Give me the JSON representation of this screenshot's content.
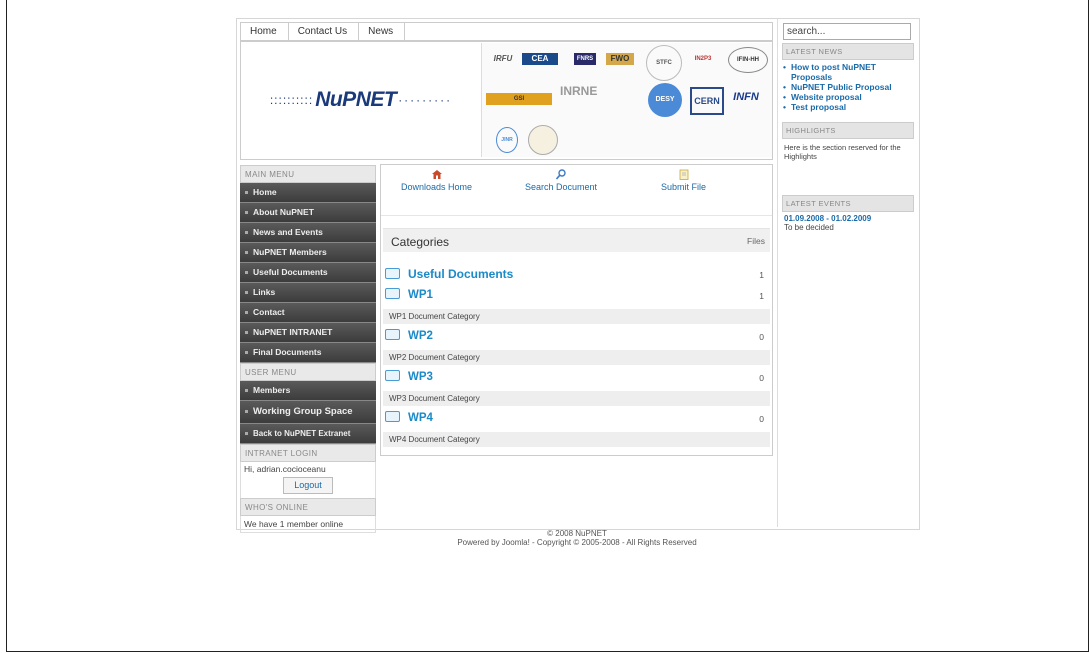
{
  "topnav": {
    "items": [
      "Home",
      "Contact Us",
      "News"
    ]
  },
  "header": {
    "brand": "NuPNET",
    "logos": [
      "IRFU",
      "CEA",
      "FNRS",
      "FWO",
      "STFC",
      "IN2P3",
      "IFIN-HH",
      "GSI",
      "INRNE",
      "DESY",
      "CERN",
      "INFN",
      "JINR"
    ]
  },
  "left": {
    "main_menu_title": "MAIN MENU",
    "main_menu": [
      "Home",
      "About NuPNET",
      "News and Events",
      "NuPNET Members",
      "Useful Documents",
      "Links",
      "Contact",
      "NuPNET INTRANET",
      "Final Documents"
    ],
    "user_menu_title": "USER MENU",
    "user_menu": [
      "Members",
      "Working Group Space",
      "Back to NuPNET Extranet"
    ],
    "login_title": "INTRANET LOGIN",
    "login_greeting": "Hi, adrian.cocioceanu",
    "logout_label": "Logout",
    "online_title": "WHO'S ONLINE",
    "online_text": "We have 1 member online"
  },
  "center": {
    "toolbar": [
      "Downloads Home",
      "Search Document",
      "Submit File"
    ],
    "categories_label": "Categories",
    "files_label": "Files",
    "categories": [
      {
        "name": "Useful Documents",
        "count": "1",
        "desc": ""
      },
      {
        "name": "WP1",
        "count": "1",
        "desc": "WP1 Document Category"
      },
      {
        "name": "WP2",
        "count": "0",
        "desc": "WP2 Document Category"
      },
      {
        "name": "WP3",
        "count": "0",
        "desc": "WP3 Document Category"
      },
      {
        "name": "WP4",
        "count": "0",
        "desc": "WP4 Document Category"
      }
    ]
  },
  "right": {
    "search_value": "search...",
    "latest_news_title": "LATEST NEWS",
    "latest_news": [
      "How to post NuPNET Proposals",
      "NuPNET Public Proposal",
      "Website proposal",
      "Test proposal"
    ],
    "highlights_title": "HIGHLIGHTS",
    "highlights_text": "Here is the section reserved for the Highlights",
    "events_title": "LATEST EVENTS",
    "event_date": "01.09.2008 - 01.02.2009",
    "event_text": "To be decided"
  },
  "footer": {
    "line1": "© 2008 NuPNET",
    "line2": "Powered by Joomla! - Copyright © 2005-2008 - All Rights Reserved"
  }
}
